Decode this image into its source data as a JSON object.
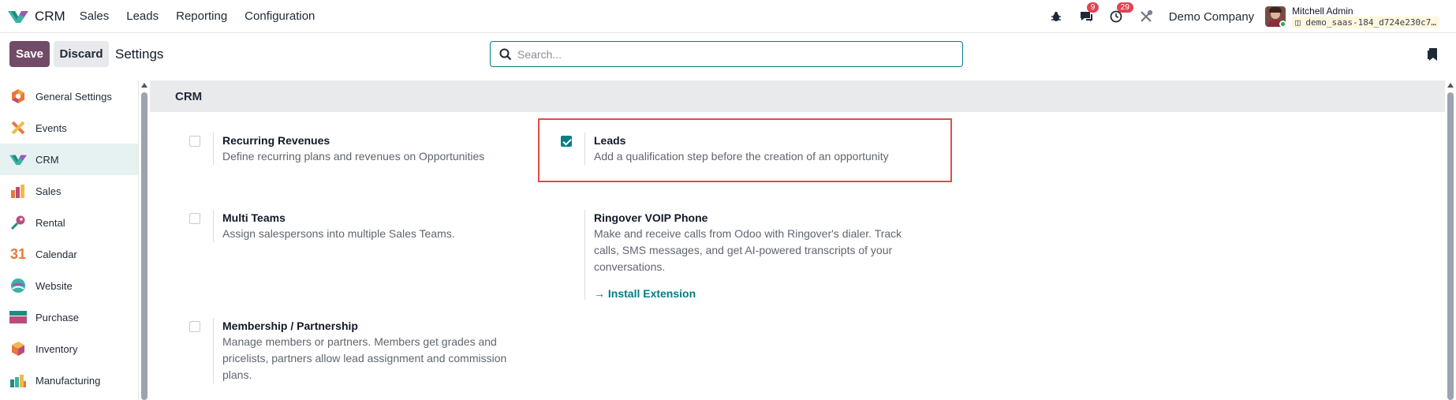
{
  "navbar": {
    "app_name": "CRM",
    "menu": [
      "Sales",
      "Leads",
      "Reporting",
      "Configuration"
    ],
    "chat_badge": "9",
    "activity_badge": "29",
    "company": "Demo Company",
    "user_name": "Mitchell Admin",
    "db_name": "demo_saas-184_d724e230c7…"
  },
  "control": {
    "save_label": "Save",
    "discard_label": "Discard",
    "title": "Settings",
    "search_placeholder": "Search..."
  },
  "sidebar": {
    "items": [
      {
        "label": "General Settings",
        "icon": "general-settings-icon",
        "active": false
      },
      {
        "label": "Events",
        "icon": "events-icon",
        "active": false
      },
      {
        "label": "CRM",
        "icon": "crm-icon",
        "active": true
      },
      {
        "label": "Sales",
        "icon": "sales-icon",
        "active": false
      },
      {
        "label": "Rental",
        "icon": "rental-icon",
        "active": false
      },
      {
        "label": "Calendar",
        "icon": "calendar-icon",
        "active": false
      },
      {
        "label": "Website",
        "icon": "website-icon",
        "active": false
      },
      {
        "label": "Purchase",
        "icon": "purchase-icon",
        "active": false
      },
      {
        "label": "Inventory",
        "icon": "inventory-icon",
        "active": false
      },
      {
        "label": "Manufacturing",
        "icon": "manufacturing-icon",
        "active": false
      }
    ],
    "calendar_glyph": "31"
  },
  "section": {
    "title": "CRM",
    "settings": {
      "recurring": {
        "title": "Recurring Revenues",
        "desc": "Define recurring plans and revenues on Opportunities",
        "checked": false
      },
      "leads": {
        "title": "Leads",
        "desc": "Add a qualification step before the creation of an opportunity",
        "checked": true
      },
      "multi_teams": {
        "title": "Multi Teams",
        "desc": "Assign salespersons into multiple Sales Teams.",
        "checked": false
      },
      "ringover": {
        "title": "Ringover VOIP Phone",
        "desc_lines": [
          "Make and receive calls from Odoo with Ringover's dialer. Track",
          "calls, SMS messages, and get AI-powered transcripts of your",
          "conversations."
        ],
        "link": "→ Install Extension"
      },
      "membership": {
        "title": "Membership / Partnership",
        "desc_lines": [
          "Manage members or partners. Members get grades and",
          "pricelists, partners allow lead assignment and commission",
          "plans."
        ],
        "checked": false
      }
    }
  },
  "colors": {
    "primary": "#714b67",
    "accent": "#017e84",
    "highlight": "#e24a4a",
    "badge": "#e04453"
  }
}
